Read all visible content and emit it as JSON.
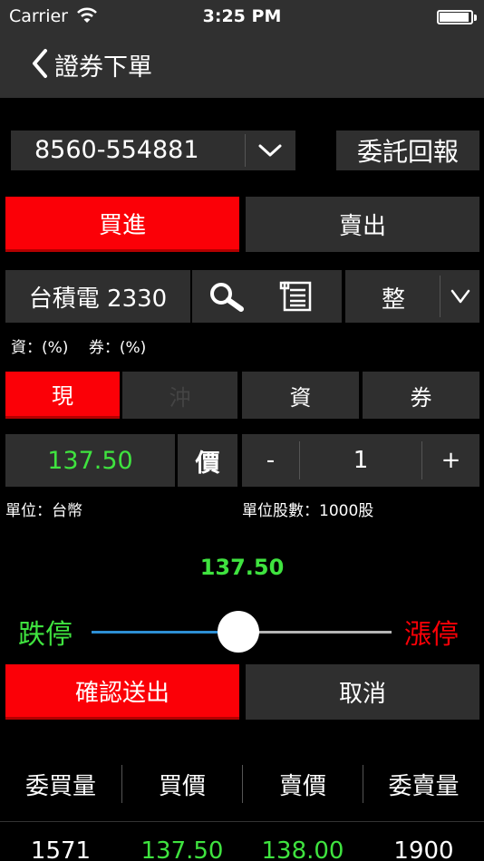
{
  "status_bar": {
    "carrier": "Carrier",
    "time": "3:25 PM"
  },
  "nav": {
    "title": "證券下單"
  },
  "account": {
    "value": "8560-554881"
  },
  "buttons": {
    "report": "委託回報",
    "buy": "買進",
    "sell": "賣出",
    "confirm": "確認送出",
    "cancel": "取消"
  },
  "stock": {
    "name_code": "台積電 2330"
  },
  "lot_type": {
    "value": "整"
  },
  "margin_info": "資：(%)　 券：(%)",
  "order_tabs": [
    "現",
    "沖",
    "資",
    "券"
  ],
  "price": {
    "value": "137.50",
    "type_label": "價"
  },
  "quantity": {
    "minus": "-",
    "value": "1",
    "plus": "+"
  },
  "unit": "單位：台幣",
  "unit_shares": "單位股數：1000股",
  "slider": {
    "price": "137.50",
    "limit_down": "跌停",
    "limit_up": "漲停",
    "position": 0.49
  },
  "order_book": {
    "headers": [
      "委買量",
      "買價",
      "賣價",
      "委賣量"
    ],
    "row": [
      "1571",
      "137.50",
      "138.00",
      "1900"
    ]
  },
  "colors": {
    "accent_red": "#fb0007",
    "price_green": "#3fe33f",
    "slider_blue": "#2d8fd4"
  },
  "icons": [
    "wifi-icon",
    "battery-icon",
    "back-chevron-icon",
    "chevron-down-icon",
    "search-icon",
    "document-icon"
  ]
}
